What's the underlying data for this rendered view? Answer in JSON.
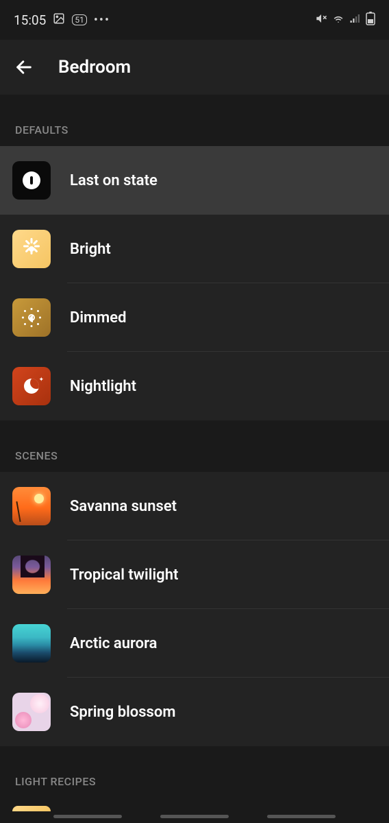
{
  "status": {
    "time": "15:05",
    "badge": "51"
  },
  "header": {
    "title": "Bedroom"
  },
  "sections": {
    "defaults_label": "DEFAULTS",
    "scenes_label": "SCENES",
    "recipes_label": "LIGHT RECIPES"
  },
  "defaults": [
    {
      "label": "Last on state"
    },
    {
      "label": "Bright"
    },
    {
      "label": "Dimmed"
    },
    {
      "label": "Nightlight"
    }
  ],
  "scenes": [
    {
      "label": "Savanna sunset"
    },
    {
      "label": "Tropical twilight"
    },
    {
      "label": "Arctic aurora"
    },
    {
      "label": "Spring blossom"
    }
  ]
}
